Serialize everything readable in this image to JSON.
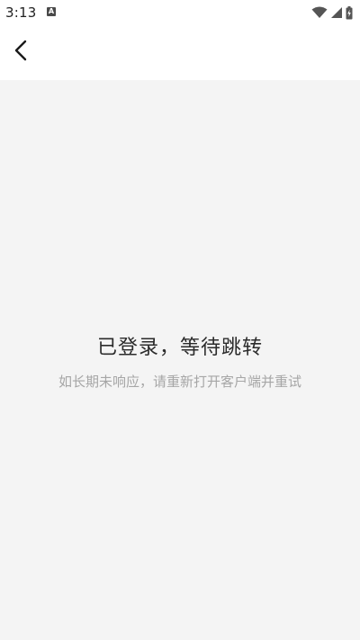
{
  "status_bar": {
    "time": "3:13",
    "notification_icon": "A",
    "icons": [
      "wifi-icon",
      "signal-icon",
      "battery-charging-icon"
    ]
  },
  "app_bar": {
    "back_icon": "chevron-left-icon"
  },
  "content": {
    "title": "已登录，等待跳转",
    "hint": "如长期未响应，请重新打开客户端并重试"
  },
  "colors": {
    "background": "#f4f4f4",
    "title": "#2b2b2b",
    "hint": "#a6a6a6"
  }
}
